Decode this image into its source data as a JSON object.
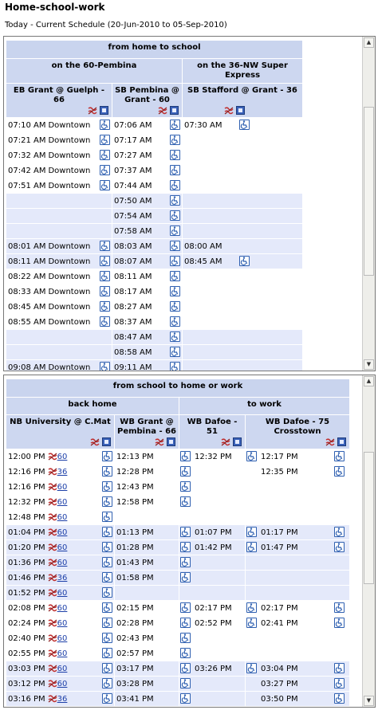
{
  "page_title": "Home-school-work",
  "subtitle": "Today - Current Schedule (20-Jun-2010 to 05-Sep-2010)",
  "table1": {
    "title": "from home to school",
    "route_a": "on the 60-Pembina",
    "route_b": "on the 36-NW Super Express",
    "stop1": "EB Grant @ Guelph - 66",
    "stop2": "SB Pembina @ Grant - 60",
    "stop3": "SB Stafford @ Grant - 36",
    "rows": [
      {
        "c1": "07:10 AM",
        "d": "Downtown",
        "c2": "07:06 AM",
        "c3": "07:30 AM",
        "w3": true,
        "sh": false
      },
      {
        "c1": "07:21 AM",
        "d": "Downtown",
        "c2": "07:17 AM",
        "c3": "",
        "w3": false,
        "sh": false
      },
      {
        "c1": "07:32 AM",
        "d": "Downtown",
        "c2": "07:27 AM",
        "c3": "",
        "w3": false,
        "sh": false
      },
      {
        "c1": "07:42 AM",
        "d": "Downtown",
        "c2": "07:37 AM",
        "c3": "",
        "w3": false,
        "sh": false
      },
      {
        "c1": "07:51 AM",
        "d": "Downtown",
        "c2": "07:44 AM",
        "c3": "",
        "w3": false,
        "sh": false
      },
      {
        "c1": "",
        "d": "",
        "c2": "07:50 AM",
        "c3": "",
        "w3": false,
        "sh": true
      },
      {
        "c1": "",
        "d": "",
        "c2": "07:54 AM",
        "c3": "",
        "w3": false,
        "sh": true
      },
      {
        "c1": "",
        "d": "",
        "c2": "07:58 AM",
        "c3": "",
        "w3": false,
        "sh": true
      },
      {
        "c1": "08:01 AM",
        "d": "Downtown",
        "c2": "08:03 AM",
        "c3": "08:00 AM",
        "w3": false,
        "sh": true
      },
      {
        "c1": "08:11 AM",
        "d": "Downtown",
        "c2": "08:07 AM",
        "c3": "08:45 AM",
        "w3": true,
        "sh": true
      },
      {
        "c1": "08:22 AM",
        "d": "Downtown",
        "c2": "08:11 AM",
        "c3": "",
        "w3": false,
        "sh": false
      },
      {
        "c1": "08:33 AM",
        "d": "Downtown",
        "c2": "08:17 AM",
        "c3": "",
        "w3": false,
        "sh": false
      },
      {
        "c1": "08:45 AM",
        "d": "Downtown",
        "c2": "08:27 AM",
        "c3": "",
        "w3": false,
        "sh": false
      },
      {
        "c1": "08:55 AM",
        "d": "Downtown",
        "c2": "08:37 AM",
        "c3": "",
        "w3": false,
        "sh": false
      },
      {
        "c1": "",
        "d": "",
        "c2": "08:47 AM",
        "c3": "",
        "w3": false,
        "sh": true
      },
      {
        "c1": "",
        "d": "",
        "c2": "08:58 AM",
        "c3": "",
        "w3": false,
        "sh": true
      },
      {
        "c1": "09:08 AM",
        "d": "Downtown",
        "c2": "09:11 AM",
        "c3": "",
        "w3": false,
        "sh": true
      }
    ]
  },
  "table2": {
    "title": "from school to home or work",
    "group_a": "back home",
    "group_b": "to work",
    "stop1": "NB University @ C.Mat",
    "stop2": "WB Grant @ Pembina - 66",
    "stop3": "WB Dafoe - 51",
    "stop4": "WB Dafoe - 75 Crosstown",
    "rows": [
      {
        "c1": "12:00 PM",
        "r": "60",
        "c2": "12:13 PM",
        "c3": "12:32 PM",
        "c4": "12:17 PM",
        "sh": false
      },
      {
        "c1": "12:16 PM",
        "r": "36",
        "c2": "12:28 PM",
        "c3": "",
        "c4": "12:35 PM",
        "sh": false
      },
      {
        "c1": "12:16 PM",
        "r": "60",
        "c2": "12:43 PM",
        "c3": "",
        "c4": "",
        "sh": false
      },
      {
        "c1": "12:32 PM",
        "r": "60",
        "c2": "12:58 PM",
        "c3": "",
        "c4": "",
        "sh": false
      },
      {
        "c1": "12:48 PM",
        "r": "60",
        "c2": "",
        "c3": "",
        "c4": "",
        "sh": false
      },
      {
        "c1": "01:04 PM",
        "r": "60",
        "c2": "01:13 PM",
        "c3": "01:07 PM",
        "c4": "01:17 PM",
        "sh": true
      },
      {
        "c1": "01:20 PM",
        "r": "60",
        "c2": "01:28 PM",
        "c3": "01:42 PM",
        "c4": "01:47 PM",
        "sh": true
      },
      {
        "c1": "01:36 PM",
        "r": "60",
        "c2": "01:43 PM",
        "c3": "",
        "c4": "",
        "sh": true
      },
      {
        "c1": "01:46 PM",
        "r": "36",
        "c2": "01:58 PM",
        "c3": "",
        "c4": "",
        "sh": true
      },
      {
        "c1": "01:52 PM",
        "r": "60",
        "c2": "",
        "c3": "",
        "c4": "",
        "sh": true
      },
      {
        "c1": "02:08 PM",
        "r": "60",
        "c2": "02:15 PM",
        "c3": "02:17 PM",
        "c4": "02:17 PM",
        "sh": false
      },
      {
        "c1": "02:24 PM",
        "r": "60",
        "c2": "02:28 PM",
        "c3": "02:52 PM",
        "c4": "02:41 PM",
        "sh": false
      },
      {
        "c1": "02:40 PM",
        "r": "60",
        "c2": "02:43 PM",
        "c3": "",
        "c4": "",
        "sh": false
      },
      {
        "c1": "02:55 PM",
        "r": "60",
        "c2": "02:57 PM",
        "c3": "",
        "c4": "",
        "sh": false
      },
      {
        "c1": "03:03 PM",
        "r": "60",
        "c2": "03:17 PM",
        "c3": "03:26 PM",
        "c4": "03:04 PM",
        "sh": true
      },
      {
        "c1": "03:12 PM",
        "r": "60",
        "c2": "03:28 PM",
        "c3": "",
        "c4": "03:27 PM",
        "sh": true
      },
      {
        "c1": "03:16 PM",
        "r": "36",
        "c2": "03:41 PM",
        "c3": "",
        "c4": "03:50 PM",
        "sh": true
      }
    ]
  }
}
